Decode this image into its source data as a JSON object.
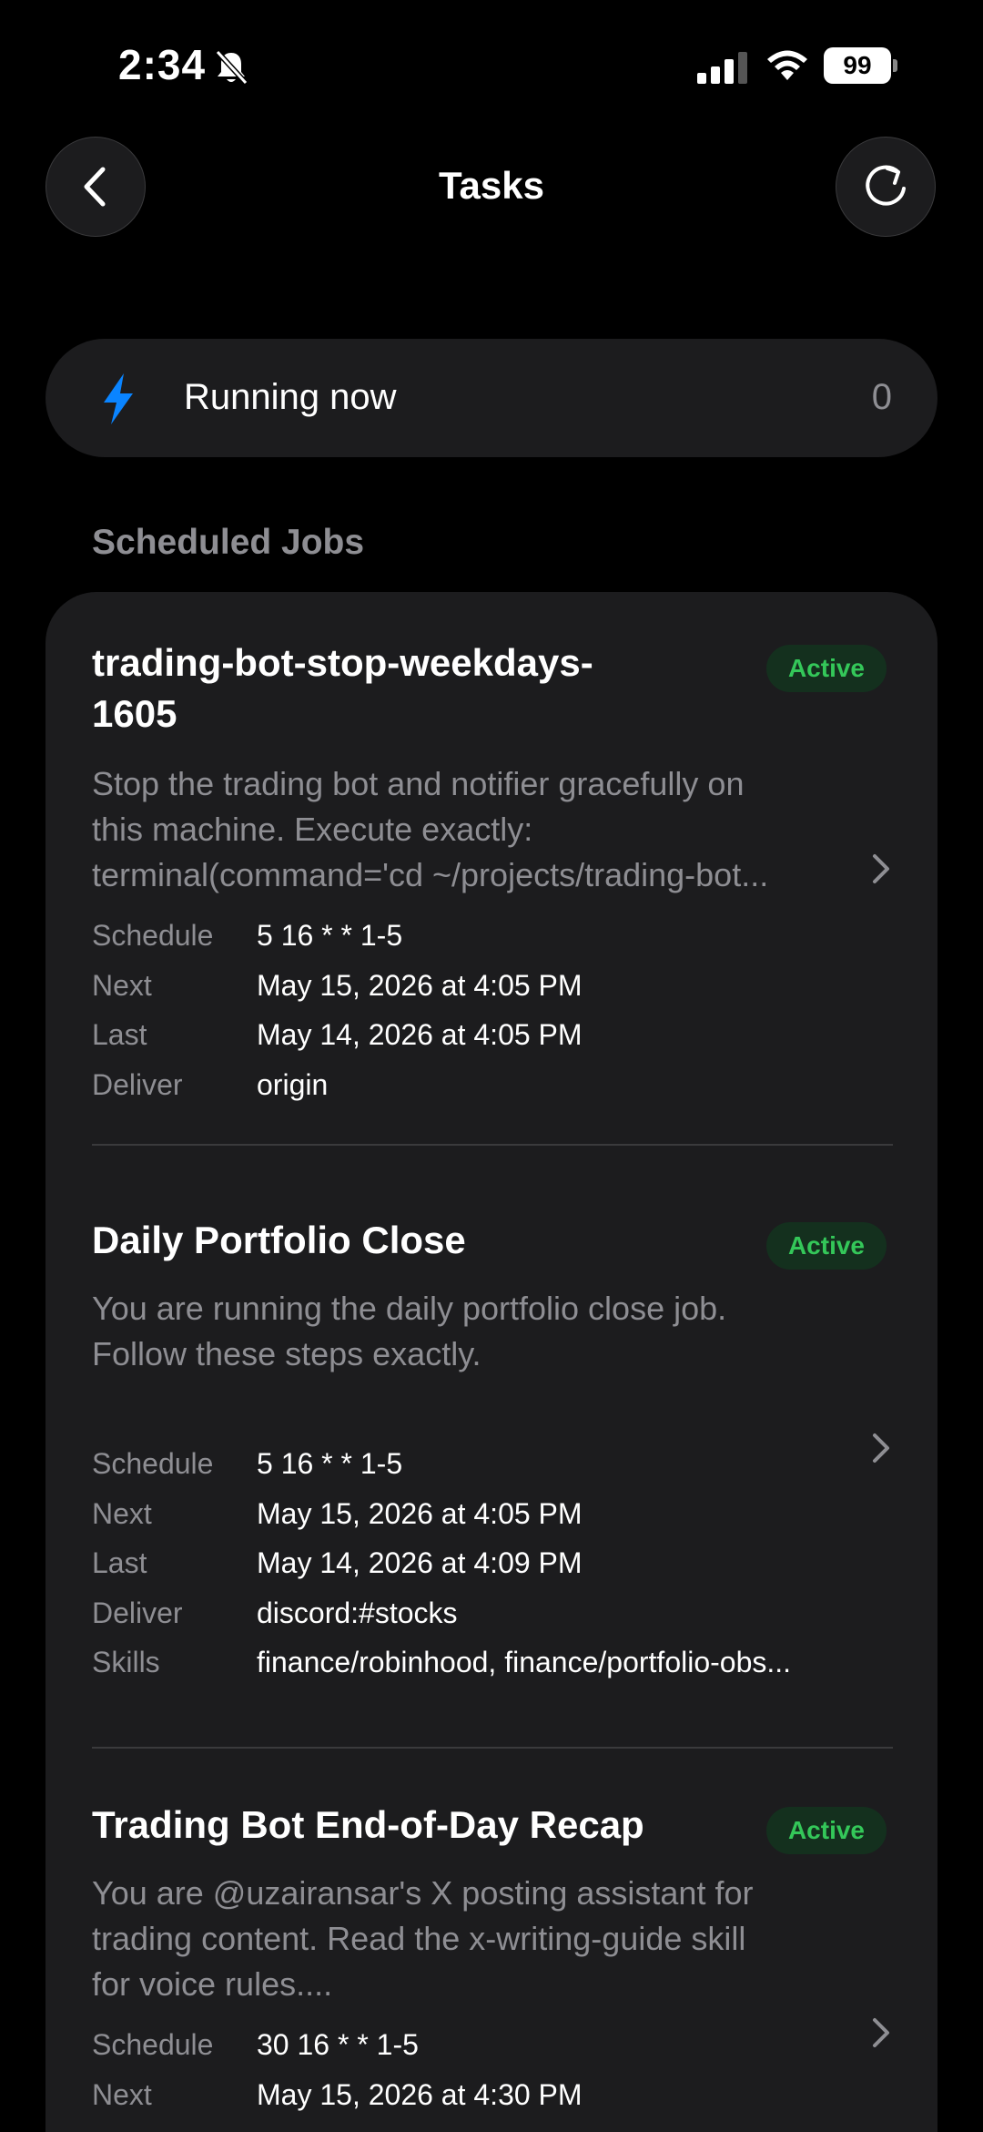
{
  "status": {
    "time": "2:34",
    "battery": "99"
  },
  "header": {
    "title": "Tasks"
  },
  "running": {
    "label": "Running now",
    "count": "0"
  },
  "section_title": "Scheduled Jobs",
  "labels": {
    "schedule": "Schedule",
    "next": "Next",
    "last": "Last",
    "deliver": "Deliver",
    "skills": "Skills"
  },
  "jobs": [
    {
      "title": "trading-bot-stop-weekdays-1605",
      "status": "Active",
      "desc": [
        "Stop the trading bot and notifier gracefully on",
        "this machine. Execute exactly:",
        "terminal(command='cd ~/projects/trading-bot..."
      ],
      "schedule": "5 16 * * 1-5",
      "next": "May 15, 2026 at 4:05 PM",
      "last": "May 14, 2026 at 4:05 PM",
      "deliver": "origin"
    },
    {
      "title": "Daily Portfolio Close",
      "status": "Active",
      "desc": [
        "You are running the daily portfolio close job.",
        "Follow these steps exactly."
      ],
      "schedule": "5 16 * * 1-5",
      "next": "May 15, 2026 at 4:05 PM",
      "last": "May 14, 2026 at 4:09 PM",
      "deliver": "discord:#stocks",
      "skills": "finance/robinhood, finance/portfolio-obs..."
    },
    {
      "title": "Trading Bot End-of-Day Recap",
      "status": "Active",
      "desc": [
        "You are @uzairansar's X posting assistant for",
        "trading content. Read the x-writing-guide skill",
        "for voice rules...."
      ],
      "schedule": "30 16 * * 1-5",
      "next": "May 15, 2026 at 4:30 PM"
    }
  ],
  "colors": {
    "accent_blue": "#0a84ff",
    "active_green": "#34c759",
    "card_bg": "#1c1c1e"
  }
}
